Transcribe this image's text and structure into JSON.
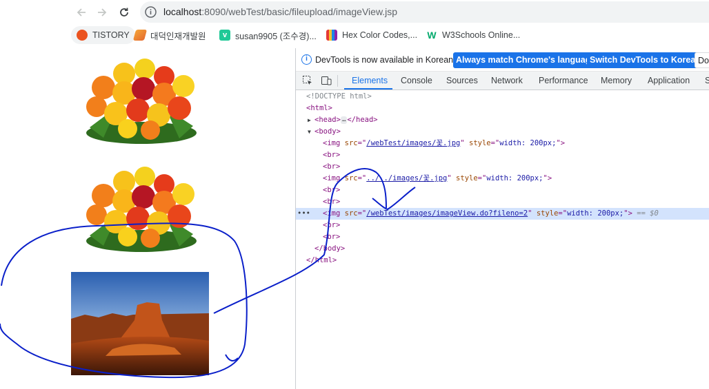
{
  "address_bar": {
    "back_icon": "arrow-left-icon",
    "forward_icon": "arrow-right-icon",
    "reload_icon": "reload-icon",
    "url_host": "localhost",
    "url_rest": ":8090/webTest/basic/fileupload/imageView.jsp"
  },
  "bookmarks": [
    {
      "label": "TISTORY",
      "color": "#eb531f"
    },
    {
      "label": "대덕인재개발원",
      "color": "#f4a338"
    },
    {
      "label": "susan9905 (조수경)...",
      "color": "#20c997"
    },
    {
      "label": "Hex Color Codes,...",
      "color": "#e53935"
    },
    {
      "label": "W3Schools Online...",
      "color": "#04aa6d"
    }
  ],
  "devtools": {
    "infobar": {
      "message": "DevTools is now available in Korean!",
      "btn_match": "Always match Chrome's language",
      "btn_switch": "Switch DevTools to Korean",
      "btn_dont": "Don"
    },
    "tabs": {
      "elements": "Elements",
      "console": "Console",
      "sources": "Sources",
      "network": "Network",
      "performance": "Performance",
      "memory": "Memory",
      "application": "Application",
      "more": "S"
    },
    "dom": {
      "doctype": "<!DOCTYPE html>",
      "html_open": "<html>",
      "head_open": "<head>",
      "head_close": "</head>",
      "body_open": "<body>",
      "img_open": "<img",
      "src_attr": "src",
      "style_attr": "style",
      "img1_src": "/webTest/images/꽃.jpg",
      "img2_src": "../../images/꽃.jpg",
      "img3_src": "/webTest/images/imageView.do?fileno=2",
      "style_val": "width: 200px;",
      "br": "<br>",
      "close_angle": ">",
      "eq_dollar": "== $0",
      "body_close": "</body>",
      "html_close": "</html>",
      "ellipsis": "…"
    }
  },
  "annotation_color": "#0a1fc9"
}
